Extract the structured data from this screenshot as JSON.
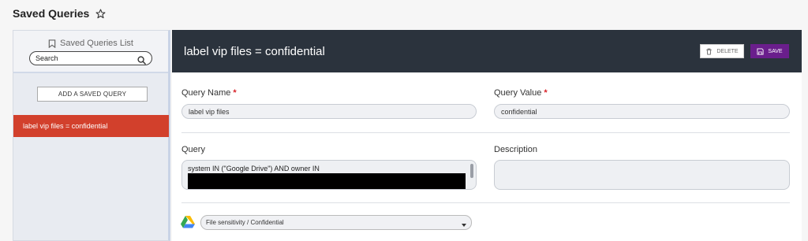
{
  "page": {
    "title": "Saved Queries"
  },
  "sidebar": {
    "list_title": "Saved Queries List",
    "search_placeholder": "Search",
    "add_button_label": "ADD A SAVED QUERY",
    "items": [
      {
        "label": "label vip files  =  confidential",
        "selected": true
      }
    ]
  },
  "editor": {
    "title": "label vip files  =  confidential",
    "delete_label": "DELETE",
    "save_label": "SAVE",
    "query_name_label": "Query Name",
    "query_name_value": "label vip files",
    "query_value_label": "Query Value",
    "query_value_value": "confidential",
    "query_label": "Query",
    "query_text": "system IN (\"Google Drive\") AND owner IN",
    "description_label": "Description",
    "description_value": "",
    "source_select_value": "File sensitivity / Confidential",
    "required_mark": "*"
  },
  "colors": {
    "selected_item": "#d2402c",
    "header_bg": "#2b333d",
    "save_button": "#6a1e8c",
    "required": "#d8232a"
  },
  "icons": [
    "star-icon",
    "bookmark-icon",
    "search-icon",
    "trash-icon",
    "save-icon",
    "google-drive-icon",
    "chevron-down-icon"
  ]
}
